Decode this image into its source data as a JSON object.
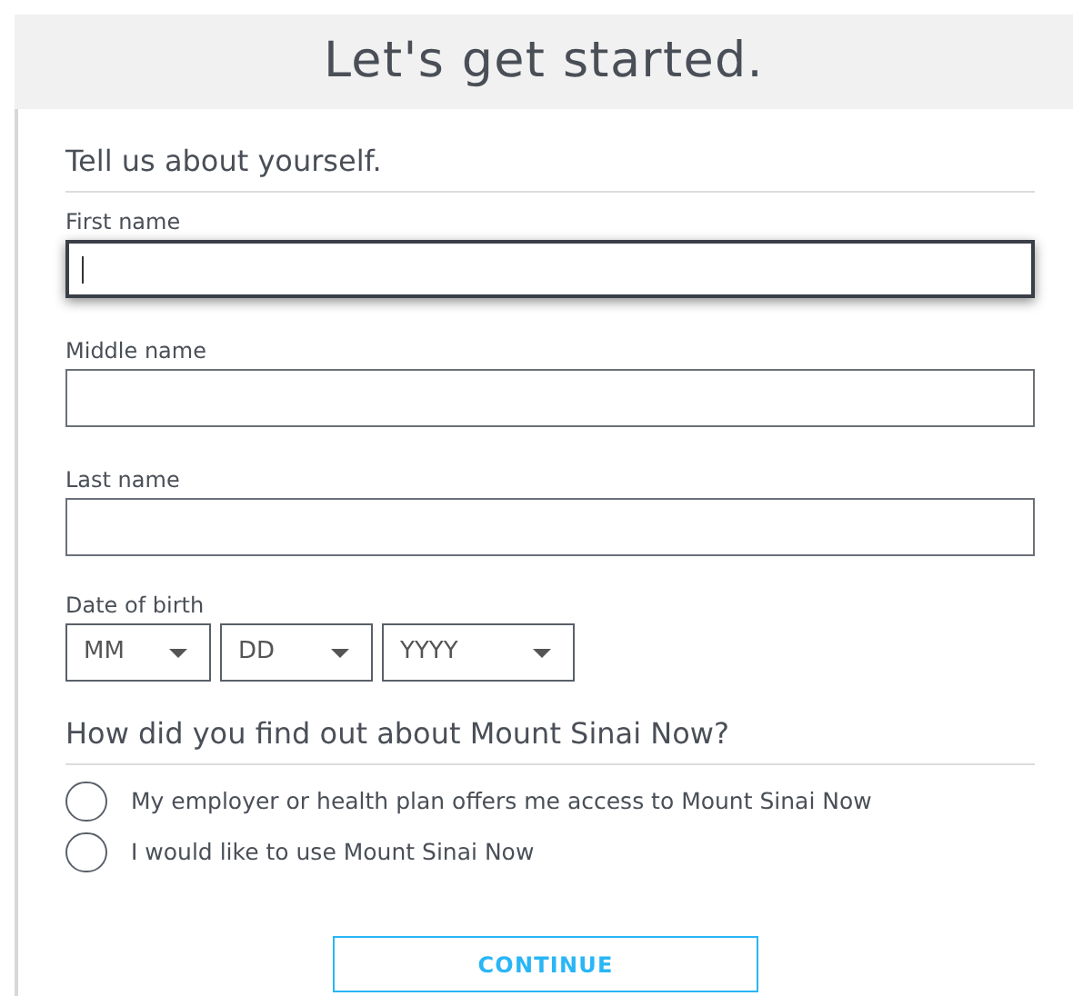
{
  "header": {
    "title": "Let's get started."
  },
  "section": {
    "title": "Tell us about yourself."
  },
  "fields": [
    {
      "label": "First name",
      "focused": true
    },
    {
      "label": "Middle name",
      "focused": false
    },
    {
      "label": "Last name",
      "focused": false
    }
  ],
  "date_of_birth": {
    "label": "Date of birth",
    "selects": [
      {
        "placeholder": "MM"
      },
      {
        "placeholder": "DD"
      },
      {
        "placeholder": "YYYY"
      }
    ]
  },
  "question": {
    "title": "How did you find out about Mount Sinai Now?",
    "options": [
      {
        "label": "My employer or health plan offers me access to Mount Sinai Now",
        "selected": false
      },
      {
        "label": "I would like to use Mount Sinai Now",
        "selected": false
      }
    ]
  },
  "continue_button": {
    "label": "CONTINUE"
  }
}
